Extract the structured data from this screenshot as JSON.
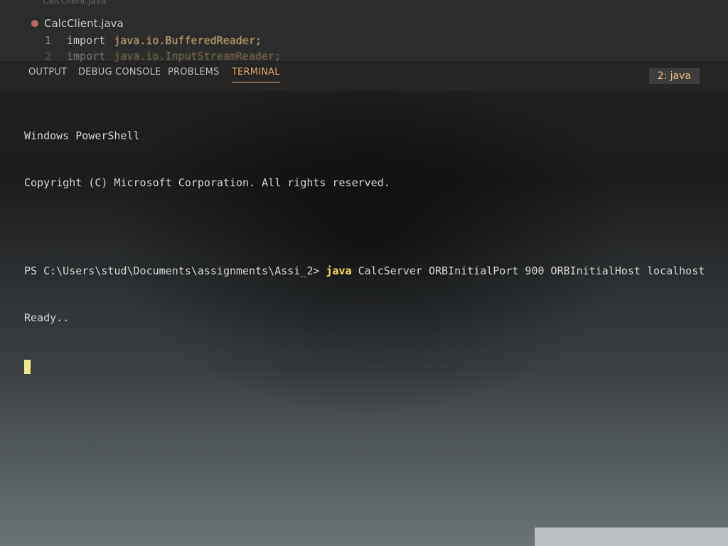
{
  "editor": {
    "top_tab_label": "CalcClient.java",
    "file_tab_label": "CalcClient.java",
    "lines": [
      {
        "number": "1",
        "keyword": "import",
        "package": "java.io.BufferedReader;"
      },
      {
        "number": "2",
        "keyword": "import",
        "package": "java.io.InputStreamReader;"
      }
    ]
  },
  "panel": {
    "tabs": [
      {
        "label": "OUTPUT"
      },
      {
        "label": "DEBUG CONSOLE"
      },
      {
        "label": "PROBLEMS"
      },
      {
        "label": "TERMINAL"
      }
    ],
    "active_tab": "TERMINAL",
    "terminal_selector": "2: java"
  },
  "terminal": {
    "header_line_1": "Windows PowerShell",
    "header_line_2": "Copyright (C) Microsoft Corporation. All rights reserved.",
    "prompt": "PS C:\\Users\\stud\\Documents\\assignments\\Assi_2> ",
    "command_exe": "java",
    "command_args": " CalcServer ORBInitialPort 900 ORBInitialHost localhost",
    "output_line": "Ready.."
  },
  "colors": {
    "accent_active_tab": "#e0a96a",
    "command_highlight": "#f5e14a",
    "cursor": "#f0e68c"
  }
}
